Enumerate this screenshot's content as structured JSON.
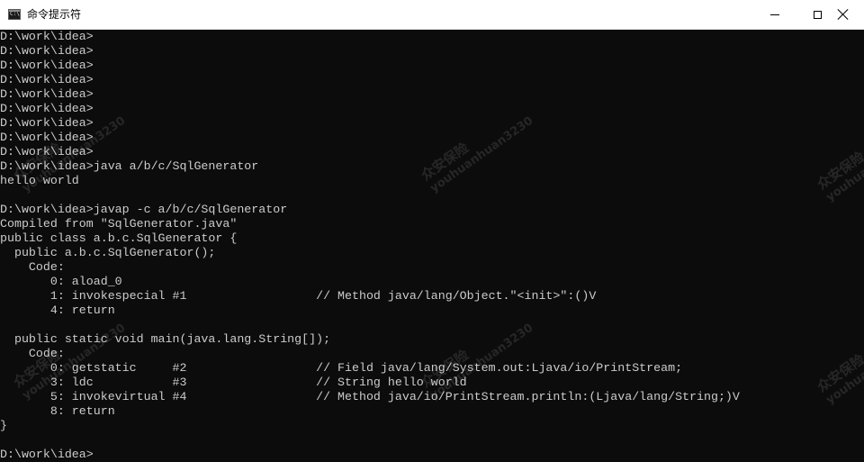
{
  "window": {
    "title": "命令提示符",
    "icon": "cmd-icon",
    "icon_text": "C:\\"
  },
  "controls": {
    "minimize": "minimize-icon",
    "maximize": "maximize-icon",
    "close": "close-icon"
  },
  "console": {
    "lines": [
      "D:\\work\\idea>",
      "D:\\work\\idea>",
      "D:\\work\\idea>",
      "D:\\work\\idea>",
      "D:\\work\\idea>",
      "D:\\work\\idea>",
      "D:\\work\\idea>",
      "D:\\work\\idea>",
      "D:\\work\\idea>",
      "D:\\work\\idea>java a/b/c/SqlGenerator",
      "hello world",
      "",
      "D:\\work\\idea>javap -c a/b/c/SqlGenerator",
      "Compiled from \"SqlGenerator.java\"",
      "public class a.b.c.SqlGenerator {",
      "  public a.b.c.SqlGenerator();",
      "    Code:",
      "       0: aload_0",
      "       1: invokespecial #1                  // Method java/lang/Object.\"<init>\":()V",
      "       4: return",
      "",
      "  public static void main(java.lang.String[]);",
      "    Code:",
      "       0: getstatic     #2                  // Field java/lang/System.out:Ljava/io/PrintStream;",
      "       3: ldc           #3                  // String hello world",
      "       5: invokevirtual #4                  // Method java/io/PrintStream.println:(Ljava/lang/String;)V",
      "       8: return",
      "}",
      "",
      "D:\\work\\idea>"
    ]
  },
  "watermark": {
    "brand": "众安保险",
    "handle": "youhuanhuan3230"
  },
  "colors": {
    "console_background": "#0c0c0c",
    "console_text": "#cccccc",
    "titlebar_background": "#ffffff"
  }
}
